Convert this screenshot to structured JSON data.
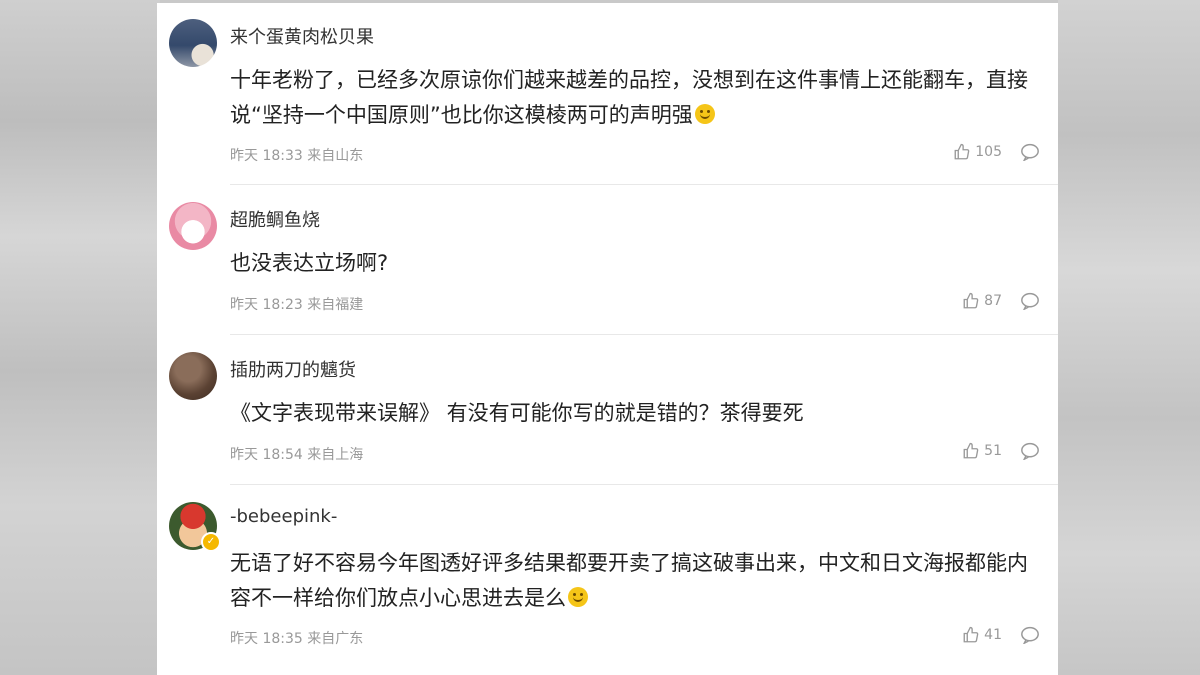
{
  "comments": [
    {
      "username": "来个蛋黄肉松贝果",
      "text": "十年老粉了，已经多次原谅你们越来越差的品控，没想到在这件事情上还能翻车，直接说“坚持一个中国原则”也比你这模棱两可的声明强",
      "time": "昨天 18:33",
      "location": "来自山东",
      "likes": "105",
      "emoji": "smile-emoji"
    },
    {
      "username": "超脆鲷鱼烧",
      "text": "也没表达立场啊?",
      "time": "昨天 18:23",
      "location": "来自福建",
      "likes": "87"
    },
    {
      "username": "插肋两刀的魑货",
      "text": "《文字表现带来误解》 有没有可能你写的就是错的？茶得要死",
      "time": "昨天 18:54",
      "location": "来自上海",
      "likes": "51"
    },
    {
      "username": "-bebeepink-",
      "text": "无语了好不容易今年图透好评多结果都要开卖了搞这破事出来，中文和日文海报都能内容不一样给你们放点小心思进去是么",
      "time": "昨天 18:35",
      "location": "来自广东",
      "likes": "41",
      "emoji": "smile-emoji",
      "verified": true
    }
  ],
  "icons": {
    "like": "thumbs-up-icon",
    "reply": "comment-bubble-icon"
  },
  "colors": {
    "text": "#222222",
    "meta": "#999999",
    "divider": "#e8e8e8",
    "background": "#c9c9c9"
  }
}
